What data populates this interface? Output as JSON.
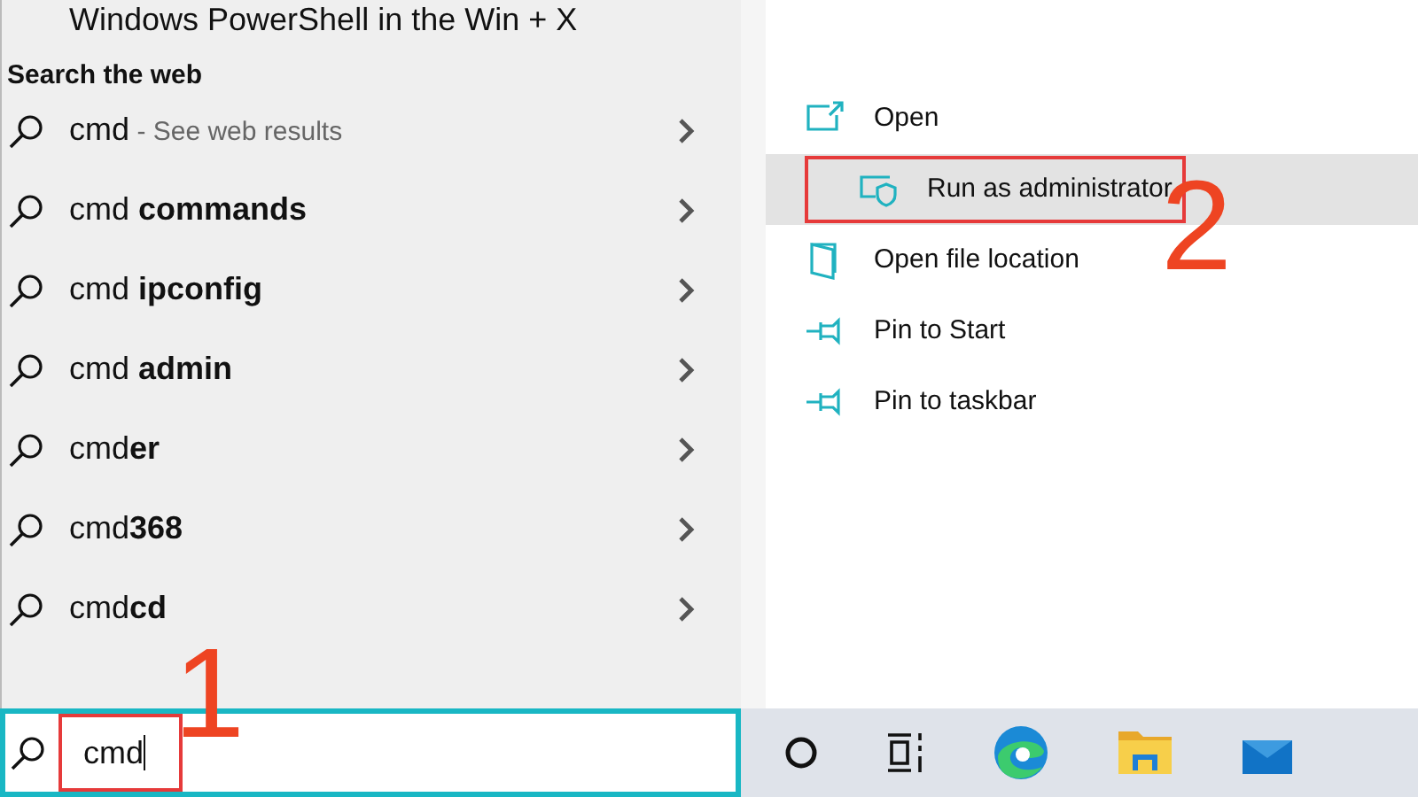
{
  "top_cut_text": "Windows PowerShell in the Win + X",
  "section_heading": "Search the web",
  "web_results": [
    {
      "text": "cmd",
      "hint": "- See web results"
    },
    {
      "text": "cmd **commands**"
    },
    {
      "text": "cmd **ipconfig**"
    },
    {
      "text": "cmd **admin**"
    },
    {
      "text": "cmd**er**"
    },
    {
      "text": "cmd**368**"
    },
    {
      "text": "cmd**cd**"
    }
  ],
  "context_menu": [
    {
      "kind": "open",
      "label": "Open",
      "selected": false,
      "framed": false
    },
    {
      "kind": "shield",
      "label": "Run as administrator",
      "selected": true,
      "framed": true
    },
    {
      "kind": "folder",
      "label": "Open file location",
      "selected": false,
      "framed": false
    },
    {
      "kind": "pin",
      "label": "Pin to Start",
      "selected": false,
      "framed": false
    },
    {
      "kind": "pin",
      "label": "Pin to taskbar",
      "selected": false,
      "framed": false
    }
  ],
  "search_box": {
    "value": "cmd",
    "framed": true
  },
  "step_numbers": [
    "1",
    "2"
  ],
  "taskbar_icons": [
    {
      "kind": "cortana"
    },
    {
      "kind": "task-view"
    },
    {
      "kind": "edge"
    },
    {
      "kind": "folder"
    },
    {
      "kind": "mail"
    }
  ]
}
